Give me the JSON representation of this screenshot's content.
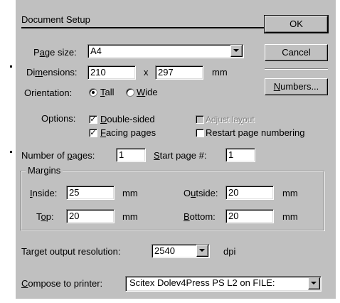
{
  "dialog": {
    "title": "Document Setup",
    "page_size": {
      "label": "Page size:",
      "value": "A4"
    },
    "dimensions": {
      "label": "Dimensions:",
      "width": "210",
      "separator": "x",
      "height": "297",
      "unit": "mm"
    },
    "orientation": {
      "label": "Orientation:",
      "options": [
        "Tall",
        "Wide"
      ],
      "selected": "Tall"
    },
    "options": {
      "label": "Options:",
      "double_sided": {
        "label": "Double-sided",
        "checked": true
      },
      "facing_pages": {
        "label": "Facing pages",
        "checked": true
      },
      "adjust_layout": {
        "label": "Adjust layout",
        "checked": false,
        "enabled": false
      },
      "restart_numbering": {
        "label": "Restart page numbering",
        "checked": false
      }
    },
    "number_of_pages": {
      "label": "Number of pages:",
      "value": "1"
    },
    "start_page": {
      "label": "Start page #:",
      "value": "1"
    },
    "margins": {
      "title": "Margins",
      "inside": {
        "label": "Inside:",
        "value": "25",
        "unit": "mm"
      },
      "outside": {
        "label": "Outside:",
        "value": "20",
        "unit": "mm"
      },
      "top": {
        "label": "Top:",
        "value": "20",
        "unit": "mm"
      },
      "bottom": {
        "label": "Bottom:",
        "value": "20",
        "unit": "mm"
      }
    },
    "resolution": {
      "label": "Target output resolution:",
      "value": "2540",
      "unit": "dpi"
    },
    "printer": {
      "label": "Compose to printer:",
      "value": "Scitex Dolev4Press PS L2 on FILE:"
    },
    "buttons": {
      "ok": "OK",
      "cancel": "Cancel",
      "numbers": "Numbers..."
    }
  }
}
